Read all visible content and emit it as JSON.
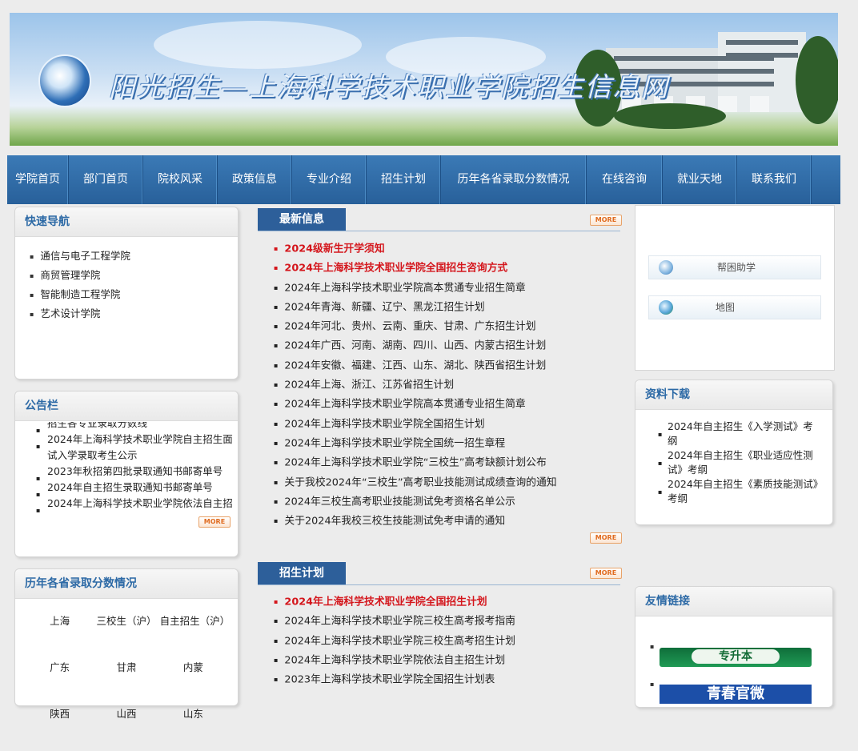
{
  "banner": {
    "title": "阳光招生—上海科学技术职业学院招生信息网"
  },
  "nav": [
    "学院首页",
    "部门首页",
    "院校风采",
    "政策信息",
    "专业介绍",
    "招生计划",
    "历年各省录取分数情况",
    "在线咨询",
    "就业天地",
    "联系我们"
  ],
  "quick_nav": {
    "title": "快速导航",
    "items": [
      "通信与电子工程学院",
      "商贸管理学院",
      "智能制造工程学院",
      "艺术设计学院"
    ]
  },
  "notice": {
    "title": "公告栏",
    "lines": [
      "招生各专业录取分数线",
      "2024年上海科学技术职业学院自主招生面试入学录取考生公示",
      "2023年秋招第四批录取通知书邮寄单号",
      "2024年自主招生录取通知书邮寄单号",
      "2024年上海科学技术职业学院依法自主招生"
    ],
    "more": "MORE"
  },
  "scores": {
    "title": "历年各省录取分数情况",
    "cells": [
      "上海",
      "三校生（沪）",
      "自主招生（沪）",
      "广东",
      "甘肃",
      "内蒙",
      "陕西",
      "山西",
      "山东"
    ]
  },
  "news": {
    "title": "最新信息",
    "more": "MORE",
    "items": [
      {
        "text": "2024级新生开学须知",
        "highlight": true
      },
      {
        "text": "2024年上海科学技术职业学院全国招生咨询方式",
        "highlight": true
      },
      {
        "text": "2024年上海科学技术职业学院高本贯通专业招生简章",
        "highlight": false
      },
      {
        "text": "2024年青海、新疆、辽宁、黑龙江招生计划",
        "highlight": false
      },
      {
        "text": "2024年河北、贵州、云南、重庆、甘肃、广东招生计划",
        "highlight": false
      },
      {
        "text": "2024年广西、河南、湖南、四川、山西、内蒙古招生计划",
        "highlight": false
      },
      {
        "text": "2024年安徽、福建、江西、山东、湖北、陕西省招生计划",
        "highlight": false
      },
      {
        "text": "2024年上海、浙江、江苏省招生计划",
        "highlight": false
      },
      {
        "text": "2024年上海科学技术职业学院高本贯通专业招生简章",
        "highlight": false
      },
      {
        "text": "2024年上海科学技术职业学院全国招生计划",
        "highlight": false
      },
      {
        "text": "2024年上海科学技术职业学院全国统一招生章程",
        "highlight": false
      },
      {
        "text": "2024年上海科学技术职业学院“三校生”高考缺额计划公布",
        "highlight": false
      },
      {
        "text": "关于我校2024年“三校生”高考职业技能测试成绩查询的通知",
        "highlight": false
      },
      {
        "text": "2024年三校生高考职业技能测试免考资格名单公示",
        "highlight": false
      },
      {
        "text": "关于2024年我校三校生技能测试免考申请的通知",
        "highlight": false
      }
    ]
  },
  "plan": {
    "title": "招生计划",
    "more": "MORE",
    "items": [
      {
        "text": "2024年上海科学技术职业学院全国招生计划",
        "highlight": true
      },
      {
        "text": "2024年上海科学技术职业学院三校生高考报考指南",
        "highlight": false
      },
      {
        "text": "2024年上海科学技术职业学院三校生高考招生计划",
        "highlight": false
      },
      {
        "text": "2024年上海科学技术职业学院依法自主招生计划",
        "highlight": false
      },
      {
        "text": "2023年上海科学技术职业学院全国招生计划表",
        "highlight": false
      }
    ]
  },
  "help": {
    "buttons": [
      "帮困助学",
      "地图"
    ]
  },
  "downloads": {
    "title": "资料下载",
    "items": [
      "2024年自主招生《入学测试》考纲",
      "2024年自主招生《职业适应性测试》考纲",
      "2024年自主招生《素质技能测试》考纲"
    ]
  },
  "friends": {
    "title": "友情链接",
    "links": [
      "专升本",
      "青春官微"
    ]
  }
}
